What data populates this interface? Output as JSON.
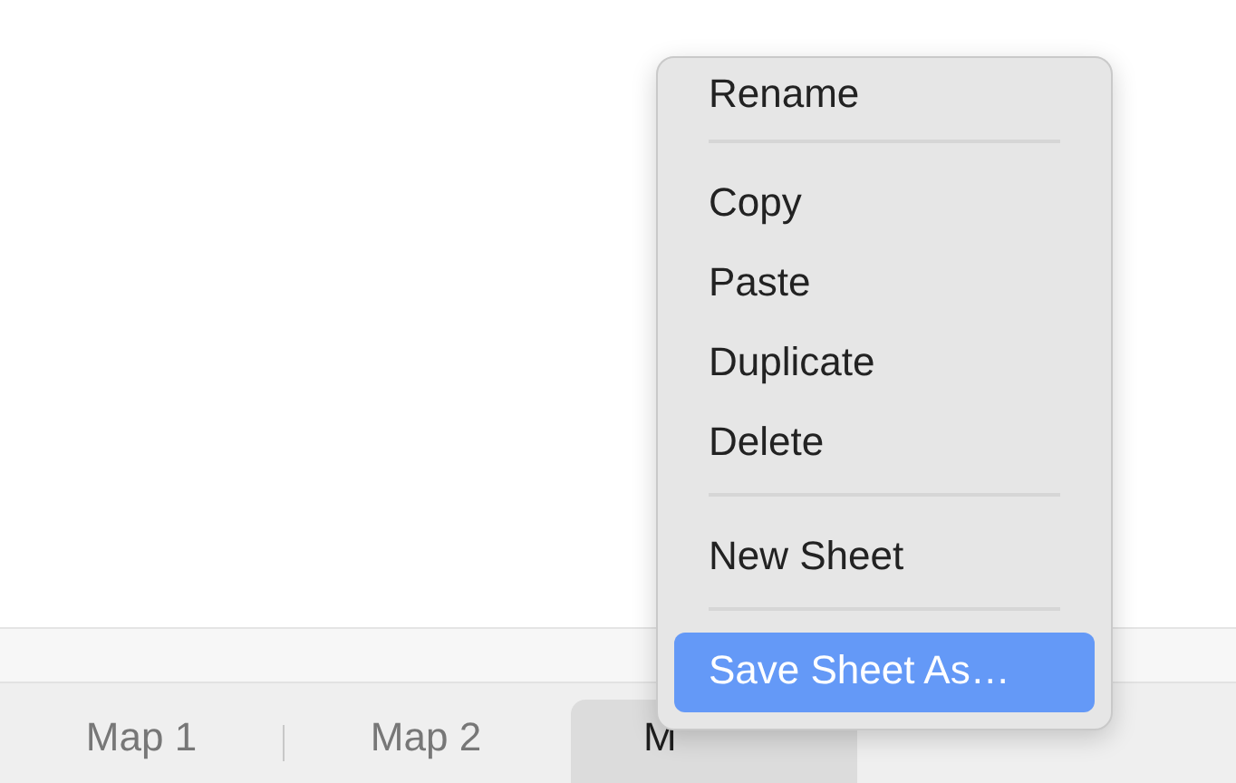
{
  "tabs": [
    {
      "label": "Map 1",
      "selected": false
    },
    {
      "label": "Map 2",
      "selected": false
    },
    {
      "label": "M",
      "selected": true
    }
  ],
  "context_menu": {
    "items": [
      {
        "kind": "item",
        "label": "Rename",
        "selected": false
      },
      {
        "kind": "separator"
      },
      {
        "kind": "item",
        "label": "Copy",
        "selected": false
      },
      {
        "kind": "item",
        "label": "Paste",
        "selected": false
      },
      {
        "kind": "item",
        "label": "Duplicate",
        "selected": false
      },
      {
        "kind": "item",
        "label": "Delete",
        "selected": false
      },
      {
        "kind": "separator"
      },
      {
        "kind": "item",
        "label": "New Sheet",
        "selected": false
      },
      {
        "kind": "separator"
      },
      {
        "kind": "item",
        "label": "Save Sheet As…",
        "selected": true
      }
    ]
  }
}
